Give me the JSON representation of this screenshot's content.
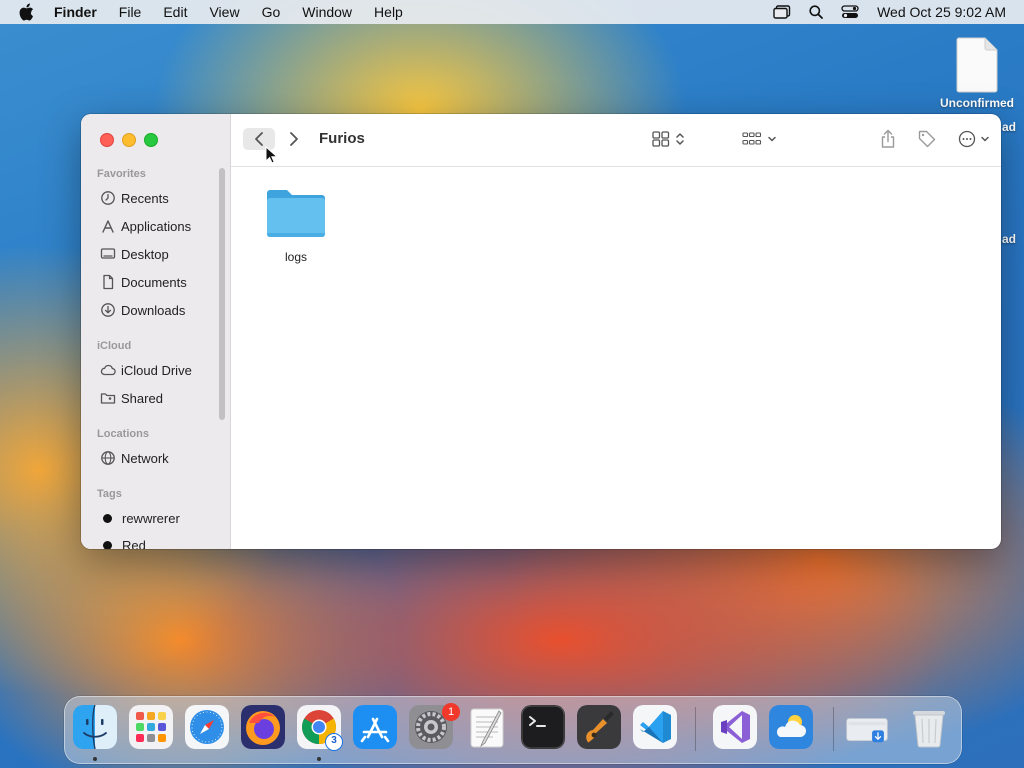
{
  "menubar": {
    "app_name": "Finder",
    "items": [
      "File",
      "Edit",
      "View",
      "Go",
      "Window",
      "Help"
    ],
    "clock": "Wed Oct 25  9:02 AM"
  },
  "desktop": {
    "file_label": "Unconfirmed",
    "partial_label_1": "ad",
    "partial_label_2": "ad"
  },
  "finder": {
    "title": "Furios",
    "sidebar": {
      "favorites_header": "Favorites",
      "favorites": [
        "Recents",
        "Applications",
        "Desktop",
        "Documents",
        "Downloads"
      ],
      "icloud_header": "iCloud",
      "icloud": [
        "iCloud Drive",
        "Shared"
      ],
      "locations_header": "Locations",
      "locations": [
        "Network"
      ],
      "tags_header": "Tags",
      "tags": [
        "rewwrerer",
        "Red"
      ]
    },
    "items": [
      {
        "name": "logs",
        "kind": "folder"
      }
    ]
  },
  "dock": {
    "apps": [
      "Finder",
      "Launchpad",
      "Safari",
      "Firefox",
      "Chrome",
      "App Store",
      "System Settings",
      "TextEdit",
      "Terminal",
      "GarageBand",
      "VS Code",
      "Visual Studio",
      "Weather",
      "Downloads",
      "Trash"
    ],
    "chrome_badge": "3",
    "settings_badge": "1"
  },
  "colors": {
    "accent": "#2f7fe0",
    "folder": "#5bb8ec",
    "close": "#fe5f57",
    "minimize": "#febc2e",
    "maximize": "#28c840"
  }
}
